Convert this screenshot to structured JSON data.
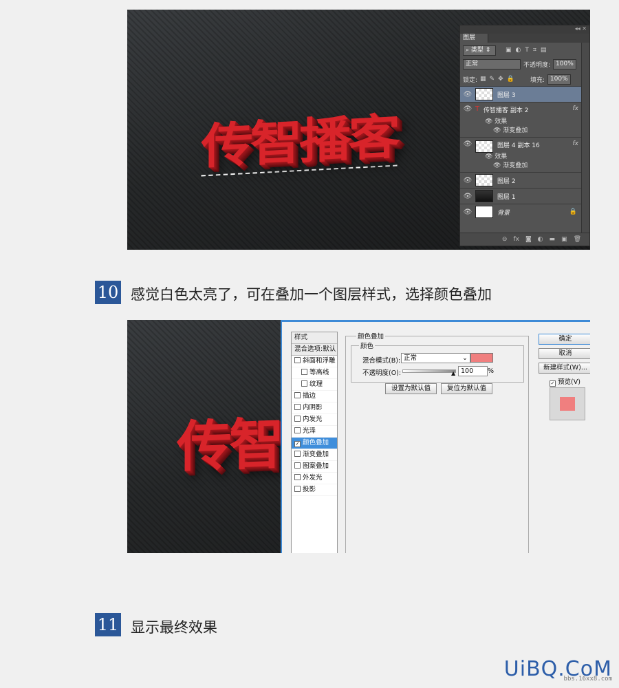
{
  "screenshot1": {
    "artwork_text": "传智播客",
    "layers_panel": {
      "tab_label": "图层",
      "filter_label": "类型",
      "blend_mode": "正常",
      "opacity_label": "不透明度:",
      "opacity_value": "100%",
      "lock_label": "锁定:",
      "fill_label": "填充:",
      "fill_value": "100%",
      "fx_label": "fx",
      "layers": [
        {
          "name": "图层 3"
        },
        {
          "name": "传智播客 副本 2",
          "effects_label": "效果",
          "effect": "渐变叠加"
        },
        {
          "name": "图层 4 副本 16",
          "effects_label": "效果",
          "effect": "渐变叠加"
        },
        {
          "name": "图层 2"
        },
        {
          "name": "图层 1"
        },
        {
          "name": "背景"
        }
      ]
    }
  },
  "step10": {
    "number": "10",
    "text": "感觉白色太亮了，可在叠加一个图层样式，选择颜色叠加"
  },
  "screenshot2": {
    "artwork_text": "传智",
    "dialog": {
      "styles_header": "样式",
      "blend_options": "混合选项:默认",
      "styles": [
        {
          "label": "斜面和浮雕",
          "checked": false,
          "indent": false
        },
        {
          "label": "等高线",
          "checked": false,
          "indent": true
        },
        {
          "label": "纹理",
          "checked": false,
          "indent": true
        },
        {
          "label": "描边",
          "checked": false,
          "indent": false
        },
        {
          "label": "内阴影",
          "checked": false,
          "indent": false
        },
        {
          "label": "内发光",
          "checked": false,
          "indent": false
        },
        {
          "label": "光泽",
          "checked": false,
          "indent": false
        },
        {
          "label": "颜色叠加",
          "checked": true,
          "indent": false
        },
        {
          "label": "渐变叠加",
          "checked": false,
          "indent": false
        },
        {
          "label": "图案叠加",
          "checked": false,
          "indent": false
        },
        {
          "label": "外发光",
          "checked": false,
          "indent": false
        },
        {
          "label": "投影",
          "checked": false,
          "indent": false
        }
      ],
      "section_title": "颜色叠加",
      "subsection_title": "颜色",
      "blend_mode_label": "混合模式(B):",
      "blend_mode_value": "正常",
      "overlay_color": "#f07f7f",
      "opacity_label": "不透明度(O):",
      "opacity_value": "100",
      "opacity_unit": "%",
      "set_default": "设置为默认值",
      "reset_default": "复位为默认值",
      "ok": "确定",
      "cancel": "取消",
      "new_style": "新建样式(W)...",
      "preview_label": "预览(V)"
    }
  },
  "step11": {
    "number": "11",
    "text": "显示最终效果"
  },
  "watermark": {
    "brand": "UiBQ.CoM",
    "url": "bbs.16xx8.com"
  }
}
